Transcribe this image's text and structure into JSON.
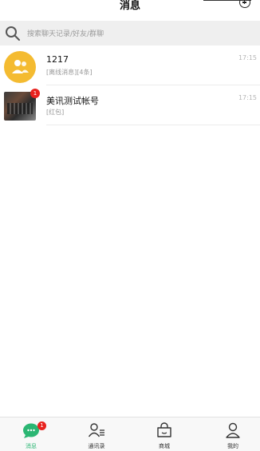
{
  "header": {
    "title": "消息"
  },
  "search": {
    "placeholder": "搜索聊天记录/好友/群聊"
  },
  "conversations": [
    {
      "name": "1217",
      "preview": "[离线消息][4条]",
      "time": "17:15",
      "avatar": "group-avatar-icon",
      "badge": ""
    },
    {
      "name": "美讯测试帐号",
      "preview": "[红包]",
      "time": "17:15",
      "avatar": "photo",
      "badge": "1"
    }
  ],
  "tabbar": {
    "tabs": [
      {
        "label": "消息",
        "icon": "chat-bubble-icon",
        "badge": "1",
        "active": true
      },
      {
        "label": "通讯录",
        "icon": "contacts-icon"
      },
      {
        "label": "商城",
        "icon": "shopping-bag-icon"
      },
      {
        "label": "我的",
        "icon": "person-icon"
      }
    ]
  },
  "colors": {
    "accent": "#2bb673",
    "badge": "#e8231f",
    "group_avatar": "#f4bb31"
  }
}
